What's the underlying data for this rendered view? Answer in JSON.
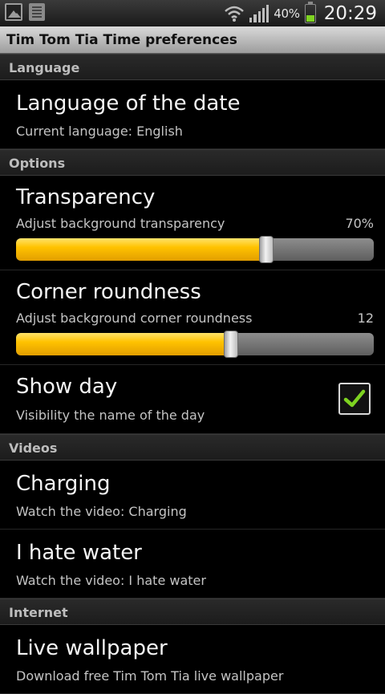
{
  "status_bar": {
    "battery_percent": "40%",
    "battery_level": 0.4,
    "time": "20:29"
  },
  "title": "Tim Tom Tia Time preferences",
  "sections": {
    "language": {
      "header": "Language",
      "language_of_date": {
        "title": "Language of the date",
        "summary": "Current language: English"
      }
    },
    "options": {
      "header": "Options",
      "transparency": {
        "title": "Transparency",
        "summary": "Adjust background transparency",
        "value_label": "70%",
        "level": 0.7
      },
      "corner_roundness": {
        "title": "Corner roundness",
        "summary": "Adjust background corner roundness",
        "value_label": "12",
        "level": 0.6
      },
      "show_day": {
        "title": "Show day",
        "summary": "Visibility the name of the day",
        "checked": true
      }
    },
    "videos": {
      "header": "Videos",
      "charging": {
        "title": "Charging",
        "summary": "Watch the video: Charging"
      },
      "i_hate_water": {
        "title": "I hate water",
        "summary": "Watch the video: I hate water"
      }
    },
    "internet": {
      "header": "Internet",
      "live_wallpaper": {
        "title": "Live wallpaper",
        "summary": "Download free Tim Tom Tia live wallpaper"
      }
    }
  },
  "colors": {
    "slider_fill": "#ffc200",
    "checkmark": "#7ed321"
  }
}
